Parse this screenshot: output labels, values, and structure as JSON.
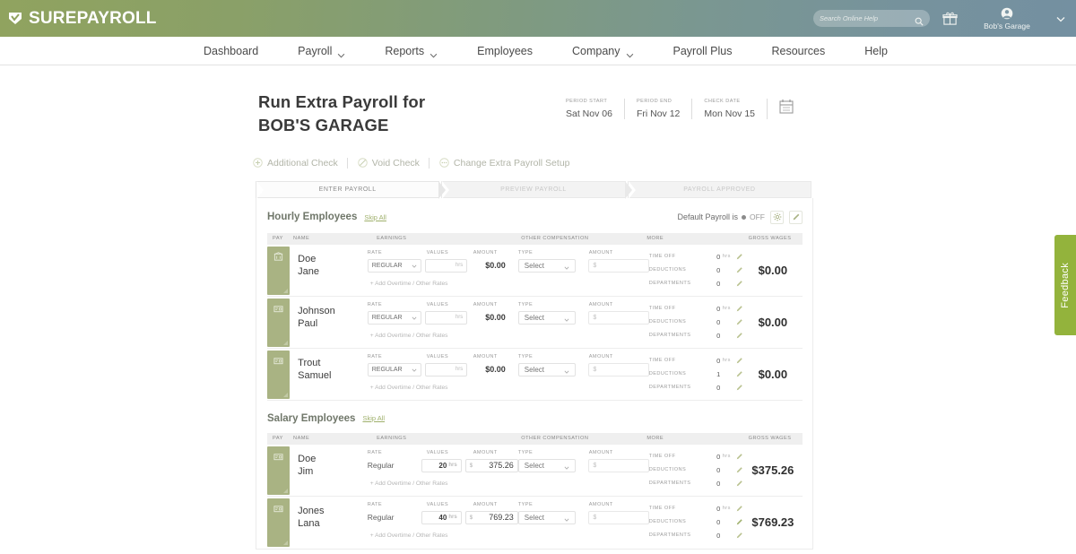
{
  "brand": {
    "name": "SUREPAYROLL",
    "logo_icon": "checkmark-shield-icon",
    "gradient_left": "#90a35f",
    "gradient_right": "#7490a1"
  },
  "topbar": {
    "search": {
      "placeholder": "Search Online Help",
      "value": "",
      "icon": "search-icon"
    },
    "gift_icon": "gift-icon",
    "avatar_icon": "user-avatar-icon",
    "user_name": "Bob's Garage",
    "caret_icon": "chevron-down-icon"
  },
  "nav": {
    "items": [
      {
        "label": "Dashboard",
        "has_caret": false
      },
      {
        "label": "Payroll",
        "has_caret": true
      },
      {
        "label": "Reports",
        "has_caret": true
      },
      {
        "label": "Employees",
        "has_caret": false
      },
      {
        "label": "Company",
        "has_caret": true
      },
      {
        "label": "Payroll Plus",
        "has_caret": false
      },
      {
        "label": "Resources",
        "has_caret": false
      },
      {
        "label": "Help",
        "has_caret": false
      }
    ]
  },
  "page": {
    "title_line1": "Run Extra Payroll for",
    "title_line2": "BOB'S GARAGE",
    "periods": [
      {
        "label": "PERIOD START",
        "value": "Sat Nov 06"
      },
      {
        "label": "PERIOD END",
        "value": "Fri Nov 12"
      },
      {
        "label": "CHECK DATE",
        "value": "Mon Nov 15"
      }
    ],
    "calendar_icon": "calendar-icon"
  },
  "action_links": [
    {
      "label": "Additional Check",
      "icon": "plus-circle-icon"
    },
    {
      "label": "Void Check",
      "icon": "void-circle-icon"
    },
    {
      "label": "Change Extra Payroll Setup",
      "icon": "ellipsis-circle-icon"
    }
  ],
  "stepper": [
    {
      "label": "ENTER PAYROLL",
      "active": true
    },
    {
      "label": "PREVIEW PAYROLL",
      "active": false
    },
    {
      "label": "PAYROLL APPROVED",
      "active": false
    }
  ],
  "columns": {
    "pay": "PAY",
    "name": "NAME",
    "earnings": "EARNINGS",
    "other_compensation": "OTHER COMPENSATION",
    "more": "MORE",
    "gross_wages": "GROSS WAGES"
  },
  "field_labels": {
    "rate": "RATE",
    "values": "VALUES",
    "amount": "AMOUNT",
    "type": "TYPE",
    "other_amount": "AMOUNT"
  },
  "more_labels": {
    "time_off": "TIME OFF",
    "deductions": "DEDUCTIONS",
    "departments": "DEPARTMENTS"
  },
  "common": {
    "skip_all": "Skip All",
    "add_overtime": "+ Add Overtime / Other Rates",
    "select_placeholder": "Select",
    "hrs_unit": "hrs",
    "currency_symbol": "$",
    "default_payroll_label": "Default Payroll is",
    "default_payroll_state": "OFF",
    "gear_icon": "gear-icon",
    "pencil_icon": "pencil-icon",
    "edit_icon": "pencil-icon"
  },
  "sections": [
    {
      "title": "Hourly Employees",
      "rows": [
        {
          "pay_icon": "bank-direct-deposit-icon",
          "last_name": "Doe",
          "first_name": "Jane",
          "rate": "REGULAR",
          "rate_is_select": true,
          "hours": "",
          "hours_placeholder": "hrs",
          "amount": "$0.00",
          "amount_is_text": true,
          "other_type": "Select",
          "other_amount": "",
          "time_off": "0",
          "time_off_unit": "hrs",
          "deductions": "0",
          "departments": "0",
          "gross": "$0.00"
        },
        {
          "pay_icon": "paper-check-icon",
          "last_name": "Johnson",
          "first_name": "Paul",
          "rate": "REGULAR",
          "rate_is_select": true,
          "hours": "",
          "hours_placeholder": "hrs",
          "amount": "$0.00",
          "amount_is_text": true,
          "other_type": "Select",
          "other_amount": "",
          "time_off": "0",
          "time_off_unit": "hrs",
          "deductions": "0",
          "departments": "0",
          "gross": "$0.00"
        },
        {
          "pay_icon": "paper-check-icon",
          "last_name": "Trout",
          "first_name": "Samuel",
          "rate": "REGULAR",
          "rate_is_select": true,
          "hours": "",
          "hours_placeholder": "hrs",
          "amount": "$0.00",
          "amount_is_text": true,
          "other_type": "Select",
          "other_amount": "",
          "time_off": "0",
          "time_off_unit": "hrs",
          "deductions": "1",
          "departments": "0",
          "gross": "$0.00"
        }
      ]
    },
    {
      "title": "Salary Employees",
      "rows": [
        {
          "pay_icon": "paper-check-icon",
          "last_name": "Doe",
          "first_name": "Jim",
          "rate": "Regular",
          "rate_is_select": false,
          "hours": "20",
          "hours_placeholder": "hrs",
          "amount": "375.26",
          "amount_is_text": false,
          "other_type": "Select",
          "other_amount": "",
          "time_off": "0",
          "time_off_unit": "hrs",
          "deductions": "0",
          "departments": "0",
          "gross": "$375.26"
        },
        {
          "pay_icon": "paper-check-icon",
          "last_name": "Jones",
          "first_name": "Lana",
          "rate": "Regular",
          "rate_is_select": false,
          "hours": "40",
          "hours_placeholder": "hrs",
          "amount": "769.23",
          "amount_is_text": false,
          "other_type": "Select",
          "other_amount": "",
          "time_off": "0",
          "time_off_unit": "hrs",
          "deductions": "0",
          "departments": "0",
          "gross": "$769.23"
        }
      ]
    }
  ],
  "feedback": {
    "label": "Feedback",
    "color": "#93b33c"
  }
}
